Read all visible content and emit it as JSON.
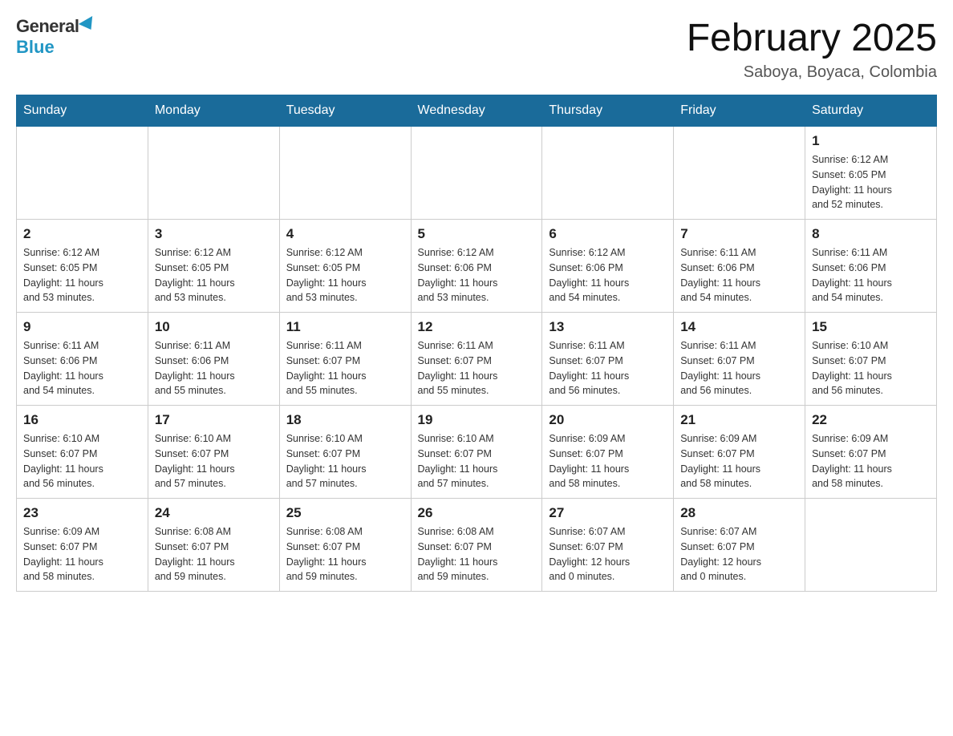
{
  "header": {
    "logo_general": "General",
    "logo_blue": "Blue",
    "title": "February 2025",
    "subtitle": "Saboya, Boyaca, Colombia"
  },
  "days_of_week": [
    "Sunday",
    "Monday",
    "Tuesday",
    "Wednesday",
    "Thursday",
    "Friday",
    "Saturday"
  ],
  "weeks": [
    [
      {
        "day": "",
        "info": ""
      },
      {
        "day": "",
        "info": ""
      },
      {
        "day": "",
        "info": ""
      },
      {
        "day": "",
        "info": ""
      },
      {
        "day": "",
        "info": ""
      },
      {
        "day": "",
        "info": ""
      },
      {
        "day": "1",
        "info": "Sunrise: 6:12 AM\nSunset: 6:05 PM\nDaylight: 11 hours\nand 52 minutes."
      }
    ],
    [
      {
        "day": "2",
        "info": "Sunrise: 6:12 AM\nSunset: 6:05 PM\nDaylight: 11 hours\nand 53 minutes."
      },
      {
        "day": "3",
        "info": "Sunrise: 6:12 AM\nSunset: 6:05 PM\nDaylight: 11 hours\nand 53 minutes."
      },
      {
        "day": "4",
        "info": "Sunrise: 6:12 AM\nSunset: 6:05 PM\nDaylight: 11 hours\nand 53 minutes."
      },
      {
        "day": "5",
        "info": "Sunrise: 6:12 AM\nSunset: 6:06 PM\nDaylight: 11 hours\nand 53 minutes."
      },
      {
        "day": "6",
        "info": "Sunrise: 6:12 AM\nSunset: 6:06 PM\nDaylight: 11 hours\nand 54 minutes."
      },
      {
        "day": "7",
        "info": "Sunrise: 6:11 AM\nSunset: 6:06 PM\nDaylight: 11 hours\nand 54 minutes."
      },
      {
        "day": "8",
        "info": "Sunrise: 6:11 AM\nSunset: 6:06 PM\nDaylight: 11 hours\nand 54 minutes."
      }
    ],
    [
      {
        "day": "9",
        "info": "Sunrise: 6:11 AM\nSunset: 6:06 PM\nDaylight: 11 hours\nand 54 minutes."
      },
      {
        "day": "10",
        "info": "Sunrise: 6:11 AM\nSunset: 6:06 PM\nDaylight: 11 hours\nand 55 minutes."
      },
      {
        "day": "11",
        "info": "Sunrise: 6:11 AM\nSunset: 6:07 PM\nDaylight: 11 hours\nand 55 minutes."
      },
      {
        "day": "12",
        "info": "Sunrise: 6:11 AM\nSunset: 6:07 PM\nDaylight: 11 hours\nand 55 minutes."
      },
      {
        "day": "13",
        "info": "Sunrise: 6:11 AM\nSunset: 6:07 PM\nDaylight: 11 hours\nand 56 minutes."
      },
      {
        "day": "14",
        "info": "Sunrise: 6:11 AM\nSunset: 6:07 PM\nDaylight: 11 hours\nand 56 minutes."
      },
      {
        "day": "15",
        "info": "Sunrise: 6:10 AM\nSunset: 6:07 PM\nDaylight: 11 hours\nand 56 minutes."
      }
    ],
    [
      {
        "day": "16",
        "info": "Sunrise: 6:10 AM\nSunset: 6:07 PM\nDaylight: 11 hours\nand 56 minutes."
      },
      {
        "day": "17",
        "info": "Sunrise: 6:10 AM\nSunset: 6:07 PM\nDaylight: 11 hours\nand 57 minutes."
      },
      {
        "day": "18",
        "info": "Sunrise: 6:10 AM\nSunset: 6:07 PM\nDaylight: 11 hours\nand 57 minutes."
      },
      {
        "day": "19",
        "info": "Sunrise: 6:10 AM\nSunset: 6:07 PM\nDaylight: 11 hours\nand 57 minutes."
      },
      {
        "day": "20",
        "info": "Sunrise: 6:09 AM\nSunset: 6:07 PM\nDaylight: 11 hours\nand 58 minutes."
      },
      {
        "day": "21",
        "info": "Sunrise: 6:09 AM\nSunset: 6:07 PM\nDaylight: 11 hours\nand 58 minutes."
      },
      {
        "day": "22",
        "info": "Sunrise: 6:09 AM\nSunset: 6:07 PM\nDaylight: 11 hours\nand 58 minutes."
      }
    ],
    [
      {
        "day": "23",
        "info": "Sunrise: 6:09 AM\nSunset: 6:07 PM\nDaylight: 11 hours\nand 58 minutes."
      },
      {
        "day": "24",
        "info": "Sunrise: 6:08 AM\nSunset: 6:07 PM\nDaylight: 11 hours\nand 59 minutes."
      },
      {
        "day": "25",
        "info": "Sunrise: 6:08 AM\nSunset: 6:07 PM\nDaylight: 11 hours\nand 59 minutes."
      },
      {
        "day": "26",
        "info": "Sunrise: 6:08 AM\nSunset: 6:07 PM\nDaylight: 11 hours\nand 59 minutes."
      },
      {
        "day": "27",
        "info": "Sunrise: 6:07 AM\nSunset: 6:07 PM\nDaylight: 12 hours\nand 0 minutes."
      },
      {
        "day": "28",
        "info": "Sunrise: 6:07 AM\nSunset: 6:07 PM\nDaylight: 12 hours\nand 0 minutes."
      },
      {
        "day": "",
        "info": ""
      }
    ]
  ]
}
